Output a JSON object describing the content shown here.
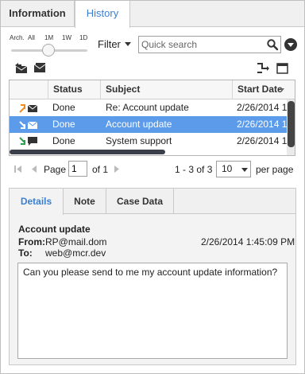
{
  "tabs": {
    "information": "Information",
    "history": "History"
  },
  "time_slider": {
    "labels": [
      "Arch.",
      "All",
      "1M",
      "1W",
      "1D"
    ],
    "selected": "1M"
  },
  "filter": {
    "label": "Filter"
  },
  "search": {
    "placeholder": "Quick search"
  },
  "grid": {
    "columns": [
      "Status",
      "Subject",
      "Start Date"
    ],
    "rows": [
      {
        "status": "Done",
        "subject": "Re: Account update",
        "start_date": "2/26/2014 1",
        "selected": false,
        "icon": "outbound-email-icon"
      },
      {
        "status": "Done",
        "subject": "Account update",
        "start_date": "2/26/2014 1",
        "selected": true,
        "icon": "inbound-email-icon"
      },
      {
        "status": "Done",
        "subject": "System support",
        "start_date": "2/26/2014 1",
        "selected": false,
        "icon": "inbound-chat-icon"
      }
    ]
  },
  "pager": {
    "page_label": "Page",
    "page_value": "1",
    "of_label": "of 1",
    "range": "1 - 3 of 3",
    "page_size": "10",
    "per_page_label": "per page"
  },
  "detail": {
    "tabs": [
      "Details",
      "Note",
      "Case Data"
    ],
    "active_tab": "Details",
    "subject": "Account update",
    "from_label": "From:",
    "from_value": "RP@mail.dom",
    "to_label": "To:",
    "to_value": "web@mcr.dev",
    "date": "2/26/2014 1:45:09 PM",
    "message": "Can you please send to me my account update information?"
  },
  "colors": {
    "accent": "#3b7fd0",
    "selection": "#5b9bea",
    "inbound_arrow": "#2e9e4f",
    "outbound_arrow": "#f08c1e"
  }
}
